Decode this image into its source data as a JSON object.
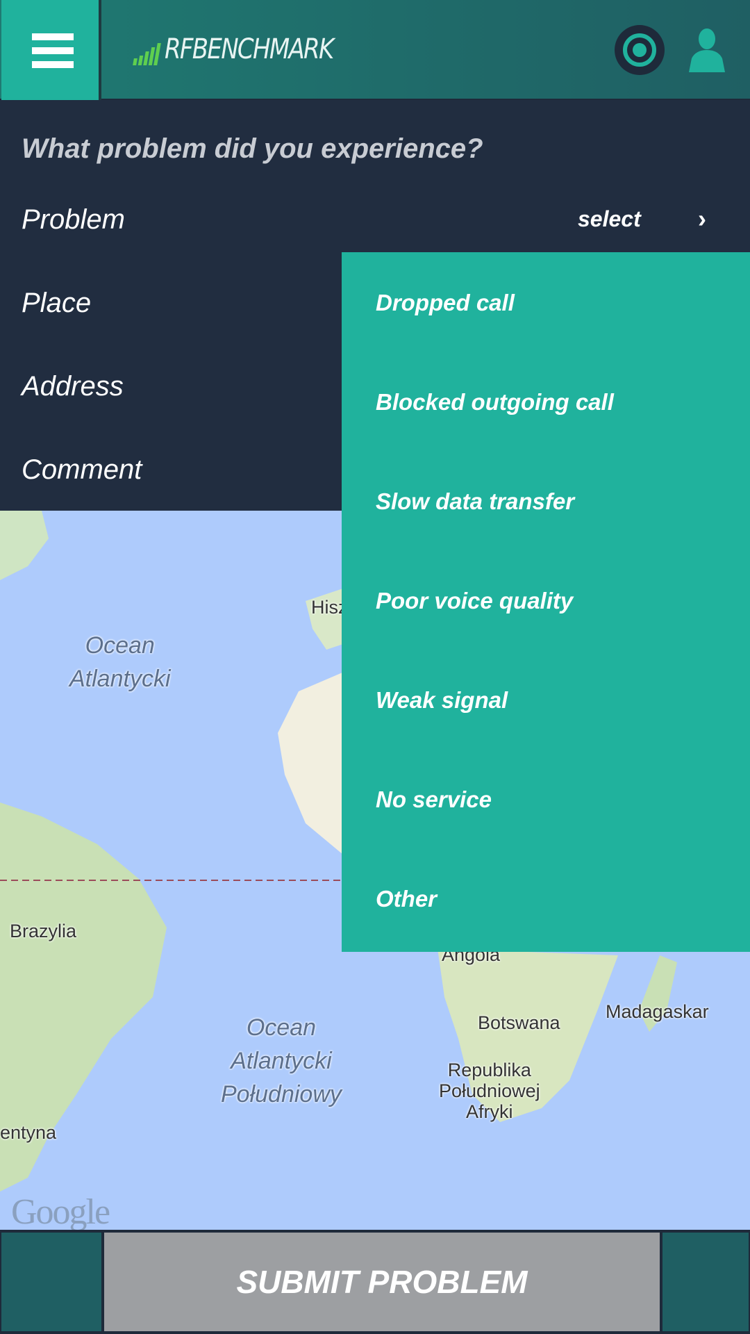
{
  "header": {
    "app_name": "RFBENCHMARK",
    "menu_icon": "hamburger-icon",
    "target_icon": "target-icon",
    "user_icon": "user-icon"
  },
  "form": {
    "question": "What problem did you experience?",
    "rows": [
      {
        "label": "Problem",
        "value": "select"
      },
      {
        "label": "Place"
      },
      {
        "label": "Address"
      },
      {
        "label": "Comment"
      }
    ]
  },
  "dropdown": {
    "options": [
      "Dropped call",
      "Blocked outgoing call",
      "Slow data transfer",
      "Poor voice quality",
      "Weak signal",
      "No service",
      "Other"
    ]
  },
  "map": {
    "labels": {
      "ocean_n": "Ocean\nAtlantycki",
      "spain": "Hisz",
      "brazil": "Brazylia",
      "angola": "Angola",
      "botswana": "Botswana",
      "madagascar": "Madagaskar",
      "ocean_s": "Ocean\nAtlantycki\nPołudniowy",
      "rsa": "Republika\nPołudniowej\nAfryki",
      "argentina": "entyna"
    },
    "attribution": "Google"
  },
  "footer": {
    "submit": "SUBMIT PROBLEM"
  },
  "colors": {
    "accent": "#20b29d",
    "panel": "#212d40",
    "header": "#1f6f6b",
    "button": "#9d9fa2",
    "ocean": "#aecbfc"
  }
}
